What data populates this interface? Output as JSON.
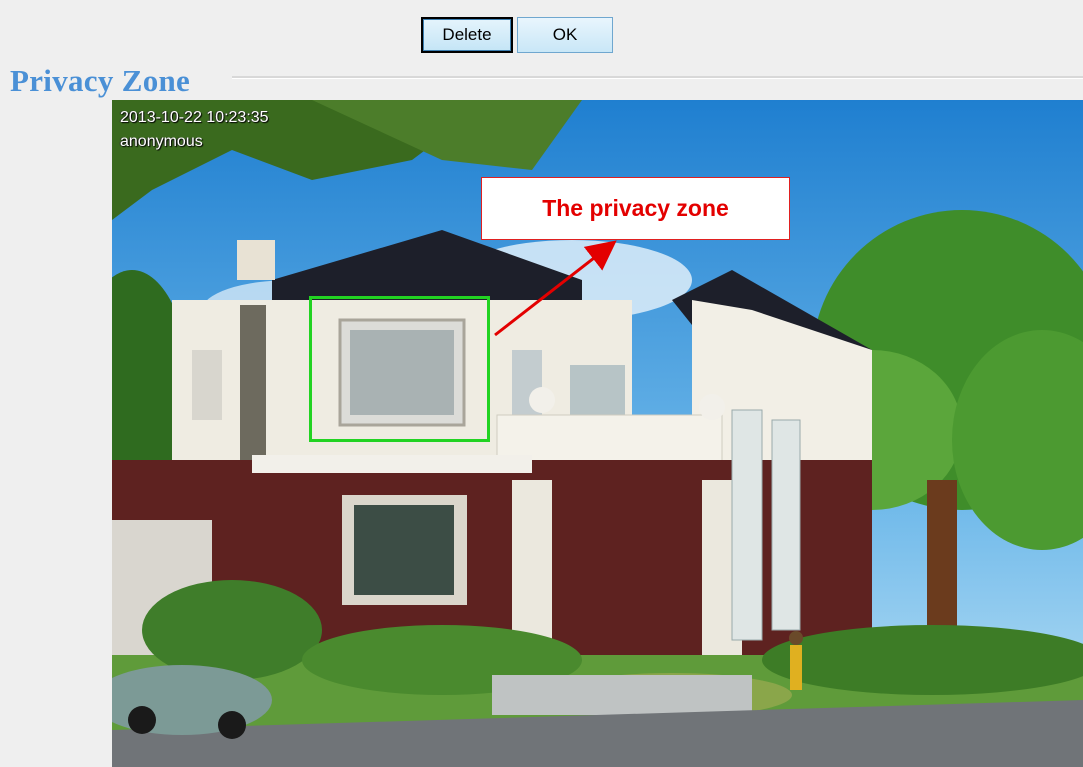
{
  "toolbar": {
    "delete_label": "Delete",
    "ok_label": "OK"
  },
  "section": {
    "title": "Privacy Zone"
  },
  "camera": {
    "timestamp": "2013-10-22 10:23:35",
    "user": "anonymous"
  },
  "annotation": {
    "callout_text": "The privacy zone",
    "zone_color": "#22d322",
    "callout_color": "#e30000"
  },
  "colors": {
    "title": "#4a90d6",
    "button_bg": "#c4e5f6"
  }
}
